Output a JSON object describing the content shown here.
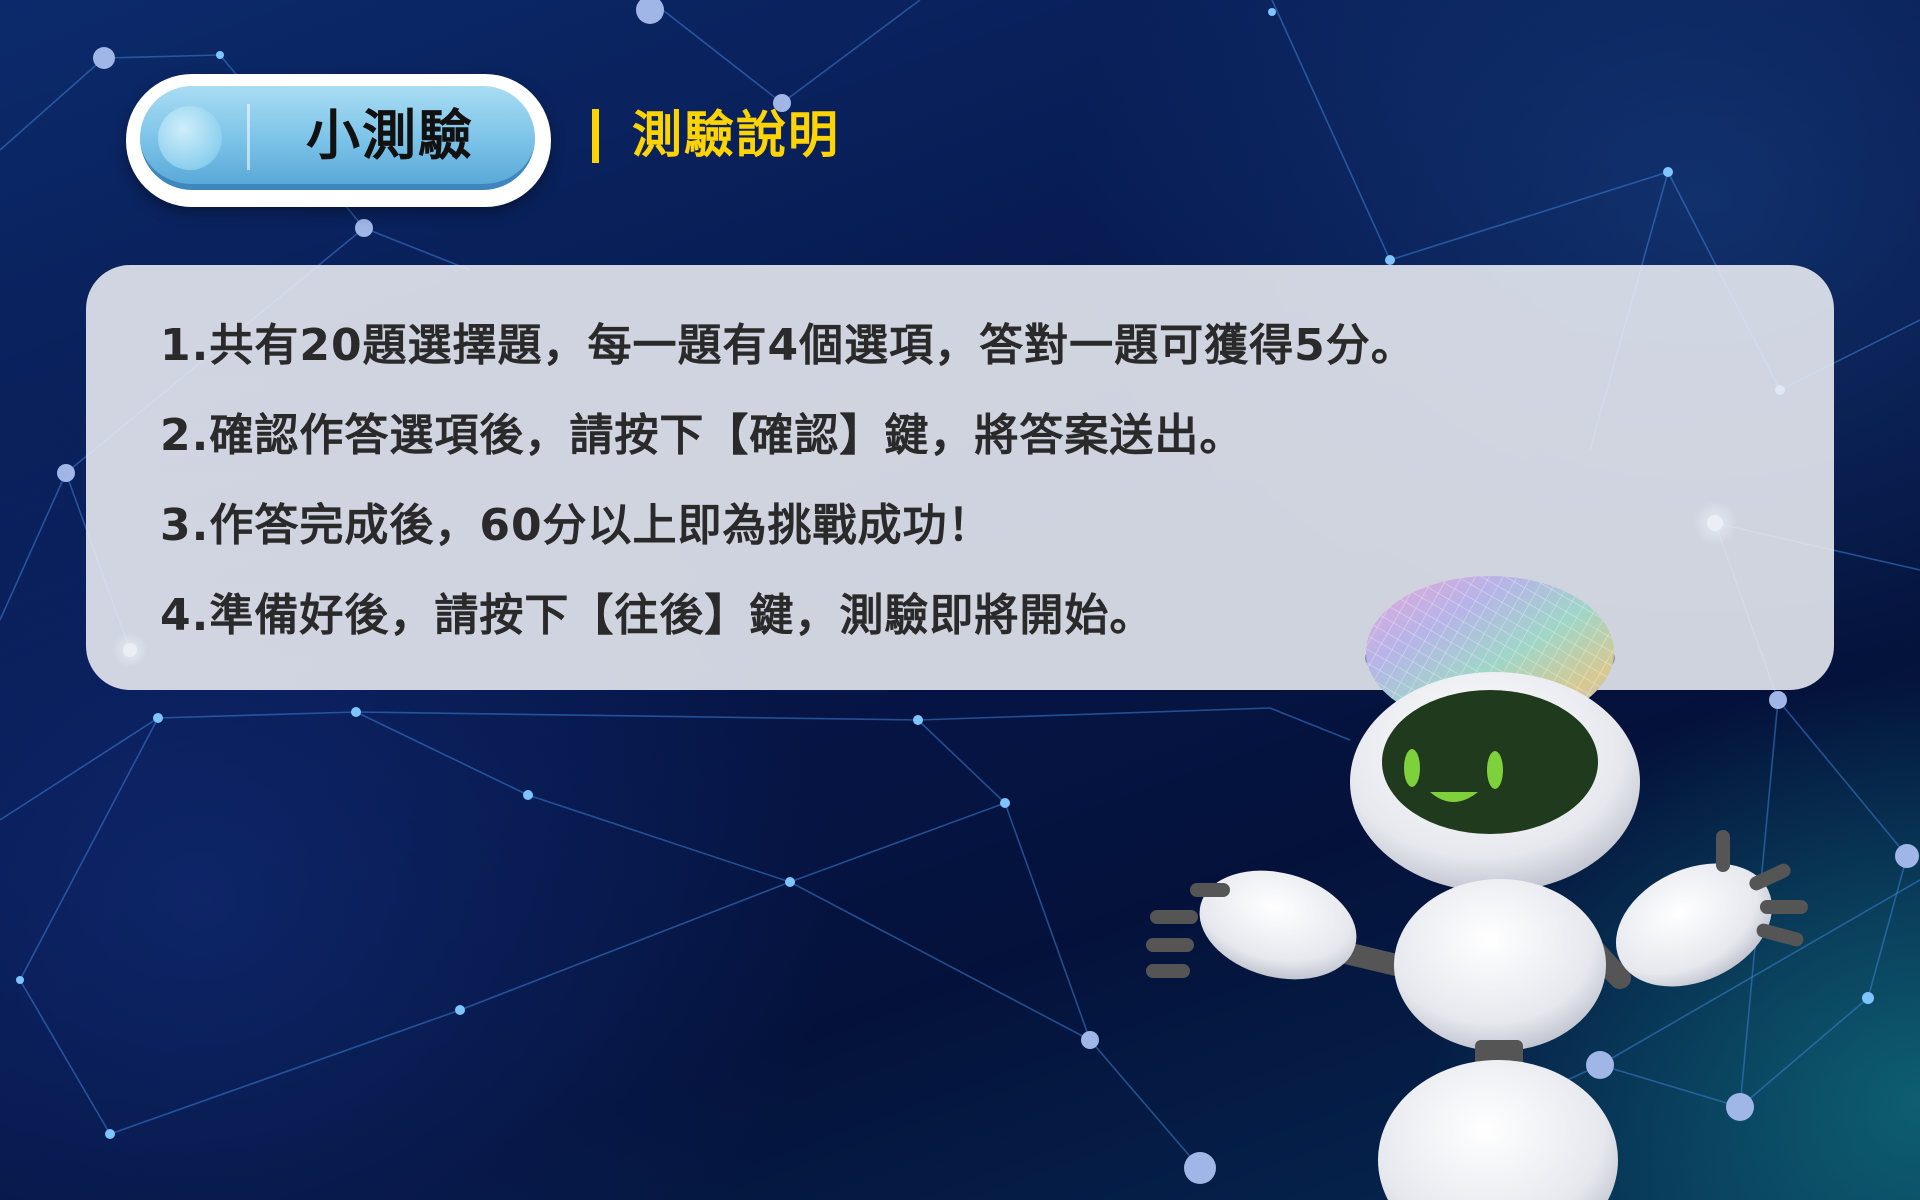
{
  "header": {
    "badge_title": "小測驗",
    "subtitle": "測驗說明"
  },
  "instructions": {
    "items": [
      "1.共有20題選擇題，每一題有4個選項，答對一題可獲得5分。",
      "2.確認作答選項後，請按下【確認】鍵，將答案送出。",
      "3.作答完成後，60分以上即為挑戰成功！",
      "4.準備好後，請按下【往後】鍵，測驗即將開始。"
    ]
  },
  "colors": {
    "subtitle_accent": "#ffd400",
    "badge_blue": "#7cc3e8",
    "robot_face": "#1f3a1c",
    "robot_eyes": "#7fd13b"
  },
  "icons": {
    "robot": "robot-mascot-icon",
    "wafer": "silicon-wafer-icon"
  }
}
